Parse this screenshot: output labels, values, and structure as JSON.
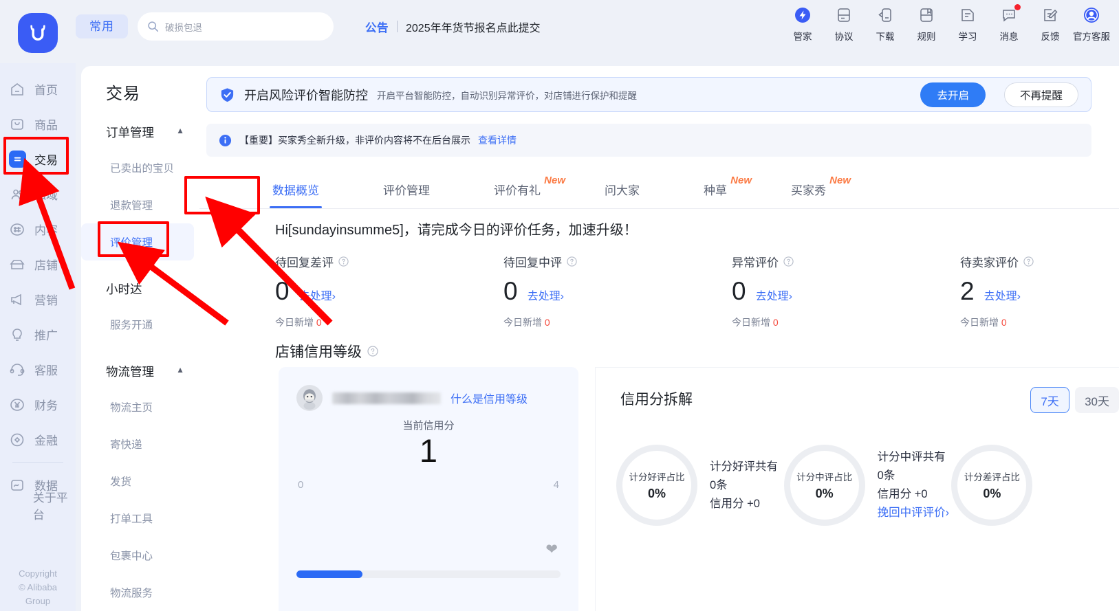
{
  "header": {
    "logo_icon": "cow-logo-icon",
    "chip_label": "常用",
    "search_placeholder": "破损包退",
    "announce_tag": "公告",
    "announce_text": "2025年年货节报名点此提交",
    "icons": [
      {
        "label": "管家",
        "icon": "steward-icon",
        "badge": false
      },
      {
        "label": "协议",
        "icon": "agreement-icon",
        "badge": false
      },
      {
        "label": "下载",
        "icon": "download-icon",
        "badge": false
      },
      {
        "label": "规则",
        "icon": "rules-icon",
        "badge": false
      },
      {
        "label": "学习",
        "icon": "study-icon",
        "badge": false
      },
      {
        "label": "消息",
        "icon": "message-icon",
        "badge": true
      },
      {
        "label": "反馈",
        "icon": "feedback-icon",
        "badge": false
      },
      {
        "label": "官方客服",
        "icon": "customer-service-icon",
        "badge": false
      }
    ]
  },
  "rail": {
    "items": [
      {
        "label": "首页",
        "icon": "home-icon",
        "active": false
      },
      {
        "label": "商品",
        "icon": "product-icon",
        "active": false
      },
      {
        "label": "交易",
        "icon": "transaction-icon",
        "active": true
      },
      {
        "label": "私域",
        "icon": "private-domain-icon",
        "active": false
      },
      {
        "label": "内容",
        "icon": "content-icon",
        "active": false
      },
      {
        "label": "店铺",
        "icon": "shop-icon",
        "active": false
      },
      {
        "label": "营销",
        "icon": "marketing-icon",
        "active": false
      },
      {
        "label": "推广",
        "icon": "promotion-icon",
        "active": false
      },
      {
        "label": "客服",
        "icon": "service-icon",
        "active": false
      },
      {
        "label": "财务",
        "icon": "finance-icon",
        "active": false
      },
      {
        "label": "金融",
        "icon": "fintech-icon",
        "active": false
      }
    ],
    "after_sep": [
      {
        "label": "数据",
        "icon": "data-icon",
        "active": false
      },
      {
        "label": "关于平台",
        "icon": "about-icon",
        "active": false
      }
    ],
    "copyright_line1": "Copyright",
    "copyright_line2": "© Alibaba",
    "copyright_line3": "Group"
  },
  "submenu": {
    "title": "交易",
    "groups": [
      {
        "label": "订单管理",
        "expanded": true,
        "links": [
          {
            "label": "已卖出的宝贝",
            "selected": false
          },
          {
            "label": "退款管理",
            "selected": false
          },
          {
            "label": "评价管理",
            "selected": true
          }
        ]
      },
      {
        "label": "小时达",
        "expanded": true,
        "links": [
          {
            "label": "服务开通",
            "selected": false
          }
        ]
      },
      {
        "label": "物流管理",
        "expanded": true,
        "links": [
          {
            "label": "物流主页",
            "selected": false
          },
          {
            "label": "寄快递",
            "selected": false
          },
          {
            "label": "发货",
            "selected": false
          },
          {
            "label": "打单工具",
            "selected": false
          },
          {
            "label": "包裹中心",
            "selected": false
          },
          {
            "label": "物流服务",
            "selected": false
          }
        ]
      }
    ]
  },
  "banner_risk": {
    "icon": "shield-check-icon",
    "title": "开启风险评价智能防控",
    "subtitle": "开启平台智能防控，自动识别异常评价，对店铺进行保护和提醒",
    "primary_label": "去开启",
    "ghost_label": "不再提醒"
  },
  "banner_notice": {
    "icon": "info-icon",
    "text": "【重要】买家秀全新升级，非评价内容将不在后台展示",
    "link": "查看详情"
  },
  "tabs": [
    {
      "label": "数据概览",
      "active": true,
      "badge": ""
    },
    {
      "label": "评价管理",
      "active": false,
      "badge": ""
    },
    {
      "label": "评价有礼",
      "active": false,
      "badge": "New"
    },
    {
      "label": "问大家",
      "active": false,
      "badge": ""
    },
    {
      "label": "种草",
      "active": false,
      "badge": "New"
    },
    {
      "label": "买家秀",
      "active": false,
      "badge": "New"
    }
  ],
  "greeting": "Hi[sundayinsumme5]，请完成今日的评价任务，加速升级！",
  "stats": [
    {
      "label": "待回复差评",
      "value": "0",
      "action": "去处理",
      "today_label": "今日新增",
      "today_value": "0"
    },
    {
      "label": "待回复中评",
      "value": "0",
      "action": "去处理",
      "today_label": "今日新增",
      "today_value": "0"
    },
    {
      "label": "异常评价",
      "value": "0",
      "action": "去处理",
      "today_label": "今日新增",
      "today_value": "0"
    },
    {
      "label": "待卖家评价",
      "value": "2",
      "action": "去处理",
      "today_label": "今日新增",
      "today_value": "0"
    }
  ],
  "credit": {
    "section_title": "店铺信用等级",
    "what_is_link": "什么是信用等级",
    "current_label": "当前信用分",
    "current_score": "1",
    "scale_min": "0",
    "scale_max": "4",
    "heart_icon": "heart-icon",
    "progress_percent": 25,
    "breakdown_title": "信用分拆解",
    "ranges": [
      {
        "label": "7天",
        "active": true
      },
      {
        "label": "30天",
        "active": false
      }
    ],
    "donuts": [
      {
        "ring_label": "计分好评占比",
        "ring_value": "0%",
        "line1": "计分好评共有0条",
        "line2": "信用分 +0",
        "link": ""
      },
      {
        "ring_label": "计分中评占比",
        "ring_value": "0%",
        "line1": "计分中评共有0条",
        "line2": "信用分 +0",
        "link": "挽回中评评价"
      },
      {
        "ring_label": "计分差评占比",
        "ring_value": "0%",
        "line1": "",
        "line2": "",
        "link": ""
      }
    ]
  },
  "annotations": {
    "color": "#ff0000",
    "boxes": [
      "rail-transaction",
      "submenu-review-management",
      "tab-data-overview"
    ],
    "arrows": 3
  }
}
